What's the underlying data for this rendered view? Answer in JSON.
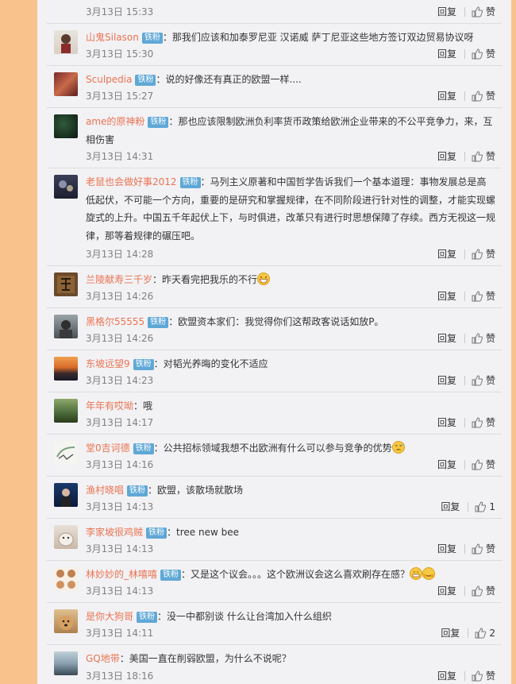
{
  "actions": {
    "reply": "回复",
    "like": "赞"
  },
  "badge": "铁粉",
  "comments": [
    {
      "user": "",
      "text": "",
      "time": "3月13日 15:33",
      "like": "赞"
    },
    {
      "user": "山鬼Silason",
      "text": "：那我们应该和加泰罗尼亚 汉诺威  萨丁尼亚这些地方签订双边贸易协议呀",
      "time": "3月13日 15:30",
      "like": "赞"
    },
    {
      "user": "Sculpedia",
      "text": "：说的好像还有真正的欧盟一样....",
      "time": "3月13日 15:27",
      "like": "赞"
    },
    {
      "user": "ame的原神粉",
      "text": "：那也应该限制欧洲负利率货币政策给欧洲企业带来的不公平竞争力，来，互相伤害",
      "time": "3月13日 14:31",
      "like": "赞"
    },
    {
      "user": "老鼠也会做好事2012",
      "text": "：马列主义原著和中国哲学告诉我们一个基本道理：事物发展总是高低起伏，不可能一个方向，重要的是研究和掌握规律，在不同阶段进行针对性的调整，才能实现螺旋式的上升。中国五千年起伏上下，与时俱进，改革只有进行时思想保障了存续。西方无视这一规律，那等着规律的碾压吧。",
      "time": "3月13日 14:28",
      "like": "赞"
    },
    {
      "user": "兰陵献寿三千岁",
      "text": "：昨天看完把我乐的不行",
      "time": "3月13日 14:26",
      "like": "赞"
    },
    {
      "user": "黑格尔55555",
      "text": "：欧盟资本家们：我觉得你们这帮政客说话如放P。",
      "time": "3月13日 14:26",
      "like": "赞"
    },
    {
      "user": "东坡远望9",
      "text": "：对韬光养晦的变化不适应",
      "time": "3月13日 14:23",
      "like": "赞"
    },
    {
      "user": "年年有哎呦",
      "text": "：哦",
      "time": "3月13日 14:17",
      "like": "赞"
    },
    {
      "user": "堂0吉诃德",
      "text": "：公共招标领域我想不出欧洲有什么可以参与竞争的优势",
      "time": "3月13日 14:16",
      "like": "赞"
    },
    {
      "user": "渔村晓唱",
      "text": "：欧盟，该散场就散场",
      "time": "3月13日 14:13",
      "like": "1"
    },
    {
      "user": "李家坡很鸡贼",
      "text": "：tree new bee",
      "time": "3月13日 14:13",
      "like": "赞"
    },
    {
      "user": "林妙妙的_林嘻嘻",
      "text": "：又是这个议会。。。这个欧洲议会这么喜欢刷存在感？",
      "time": "3月13日 14:13",
      "like": "赞"
    },
    {
      "user": "是你大狗哥",
      "text": "：没一中都别谈 什么让台湾加入什么组织",
      "time": "3月13日 14:11",
      "like": "2"
    },
    {
      "user": "GQ地带",
      "text": "：美国一直在削弱欧盟，为什么不说呢？",
      "time": "3月13日 18:16",
      "like": "赞"
    }
  ]
}
